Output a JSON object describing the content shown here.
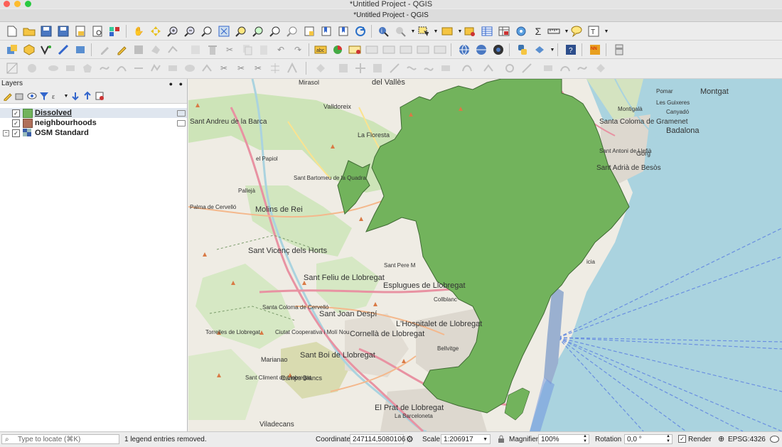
{
  "window": {
    "os_title": "*Untitled Project - QGIS",
    "app_title": "*Untitled Project - QGIS"
  },
  "layers_panel": {
    "title": "Layers",
    "items": [
      {
        "name": "Dissolved",
        "checked": true,
        "color": "#72b35c"
      },
      {
        "name": "neighbourhoods",
        "checked": true,
        "color": "#b0705a"
      },
      {
        "name": "OSM Standard",
        "checked": true,
        "color": "#3a5ea8"
      }
    ]
  },
  "map": {
    "labels": [
      "Mirasol",
      "del Vallès",
      "Valldoreix",
      "La Floresta",
      "el Papiol",
      "Sant Bartomeu de la Quadra",
      "Pallejà",
      "Molins de Rei",
      "Palma de Cervelló",
      "Sant Vicenç dels Horts",
      "Sant Feliu de Llobregat",
      "Esplugues de Llobregat",
      "Sant Joan Despí",
      "Santa Coloma de Cervelló",
      "Torrelles de Llobregat",
      "Ciutat Cooperativa i Molí Nou",
      "Cornellà de Llobregat",
      "L'Hospitalet de Llobregat",
      "Bellvitge",
      "Collblanc",
      "Sant Boi de Llobregat",
      "Marianao",
      "Sant Climent de Llobregat",
      "Camps Blancs",
      "Viladecans",
      "El Prat de Llobregat",
      "La Barceloneta",
      "Sant Pere M",
      "Montgat",
      "Pomar",
      "Les Guixeres",
      "Canyadó",
      "Santa Coloma de Gramenet",
      "Montigalà",
      "Badalona",
      "Sant Antoni de Llefià",
      "Gorg",
      "Sant Adrià de Besòs",
      "Sant Andreu de la Barca",
      "icia"
    ]
  },
  "status": {
    "search_placeholder": "Type to locate (⌘K)",
    "message": "1 legend entries removed.",
    "coordinate_label": "Coordinate",
    "coordinate_value": "247114,5080106",
    "scale_label": "Scale",
    "scale_value": "1:206917",
    "magnifier_label": "Magnifier",
    "magnifier_value": "100%",
    "rotation_label": "Rotation",
    "rotation_value": "0,0 °",
    "render_label": "Render",
    "render_checked": true,
    "crs": "EPSG:4326"
  }
}
